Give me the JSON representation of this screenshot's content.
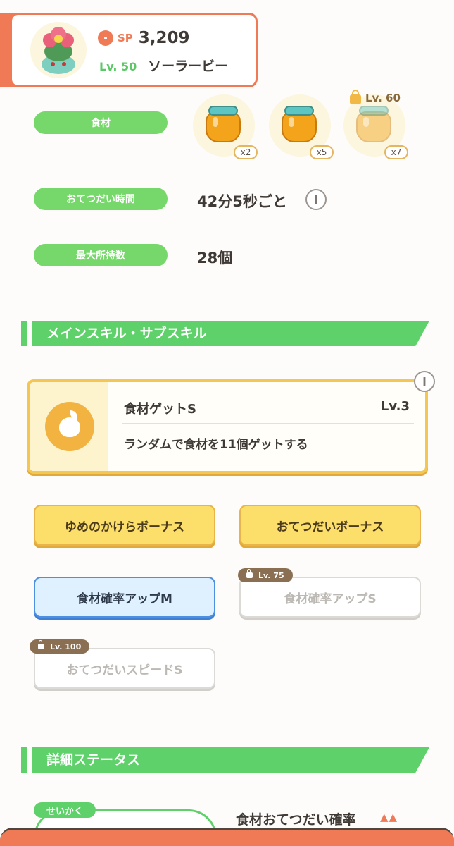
{
  "header": {
    "sp_label": "SP",
    "sp_value": "3,209",
    "level": "Lv. 50",
    "main_skill_name": "ソーラービー"
  },
  "ingredients": {
    "label": "食材",
    "items": [
      {
        "icon": "honey-jar-icon",
        "qty": "x2",
        "locked": false
      },
      {
        "icon": "honey-jar-icon",
        "qty": "x5",
        "locked": false
      },
      {
        "icon": "honey-jar-icon",
        "qty": "x7",
        "locked": true,
        "unlock_level": "Lv. 60"
      }
    ]
  },
  "help_time": {
    "label": "おてつだい時間",
    "value": "42分5秒ごと",
    "info": "i"
  },
  "max_carry": {
    "label": "最大所持数",
    "value": "28個"
  },
  "skills_section": {
    "title": "メインスキル・サブスキル"
  },
  "main_skill": {
    "icon": "apple-icon",
    "name": "食材ゲットS",
    "level": "Lv.3",
    "description": "ランダムで食材を11個ゲットする",
    "info": "i"
  },
  "sub_skills": [
    {
      "label": "ゆめのかけらボーナス",
      "style": "gold"
    },
    {
      "label": "おてつだいボーナス",
      "style": "gold"
    },
    {
      "label": "食材確率アップM",
      "style": "blue"
    },
    {
      "label": "食材確率アップS",
      "style": "gray",
      "lock_level": "Lv. 75"
    },
    {
      "label": "おてつだいスピードS",
      "style": "gray",
      "lock_level": "Lv. 100"
    }
  ],
  "detail_section": {
    "title": "詳細ステータス"
  },
  "nature": {
    "tag": "せいかく",
    "stat_label": "食材おてつだい確率",
    "arrows": "▲▲"
  },
  "colors": {
    "accent": "#f07a55",
    "green": "#5fd16a",
    "gold": "#f4c654",
    "blue": "#4d8fe0"
  }
}
